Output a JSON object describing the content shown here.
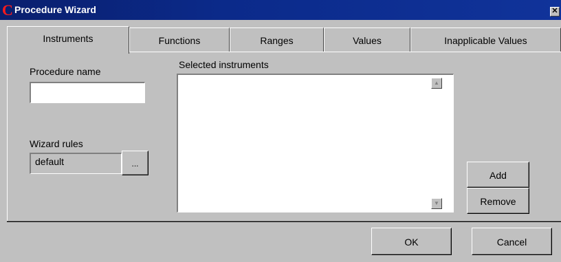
{
  "window": {
    "title": "Procedure Wizard",
    "icon": "C",
    "close_glyph": "✕"
  },
  "tabs": [
    {
      "label": "Instruments",
      "active": true
    },
    {
      "label": "Functions",
      "active": false
    },
    {
      "label": "Ranges",
      "active": false
    },
    {
      "label": "Values",
      "active": false
    },
    {
      "label": "Inapplicable Values",
      "active": false
    }
  ],
  "form": {
    "procedure_name_label": "Procedure name",
    "procedure_name_value": "",
    "wizard_rules_label": "Wizard rules",
    "wizard_rules_value": "default",
    "browse_label": "...",
    "selected_instruments_label": "Selected instruments",
    "selected_instruments": []
  },
  "buttons": {
    "add": "Add",
    "remove": "Remove",
    "ok": "OK",
    "cancel": "Cancel"
  },
  "scrollbar": {
    "up_glyph": "▲",
    "down_glyph": "▼"
  }
}
